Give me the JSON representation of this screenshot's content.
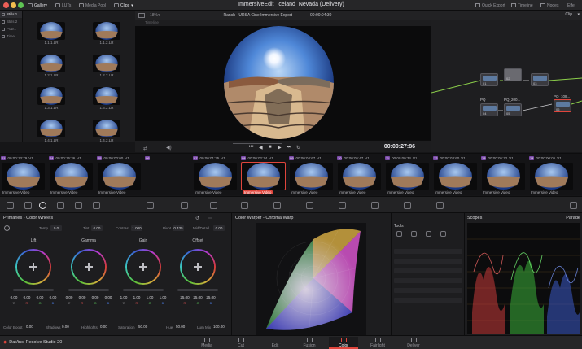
{
  "window": {
    "project_title": "ImmersiveEdit_Iceland_Nevada (Delivery)",
    "tabs": [
      {
        "label": "Gallery",
        "active": true
      },
      {
        "label": "LUTs",
        "active": false
      },
      {
        "label": "Media Pool",
        "active": false
      },
      {
        "label": "Clips",
        "active": true
      }
    ],
    "right_actions": [
      "Quick Export",
      "Timeline",
      "Nodes",
      "Effe"
    ]
  },
  "gallery": {
    "albums": [
      "Stills 1",
      "Stills 2",
      "Pow...",
      "Time..."
    ],
    "stills": [
      "1.1.1.LR",
      "1.1.2.LR",
      "1.2.1.LR",
      "1.2.2.LR",
      "1.3.1.LR",
      "1.3.2.LR",
      "1.4.1.LR",
      "1.4.2.LR"
    ]
  },
  "viewer": {
    "zoom": "18%",
    "clip_name": "Ranch - URSA Cine Immersive Export",
    "header_timecode": "00:00:04:30",
    "timeline_label": "Timeline",
    "timecode": "00:00:27:86"
  },
  "nodes": {
    "mode": "Clip",
    "node_labels": [
      "01",
      "02",
      "03",
      "04",
      "05",
      "06"
    ],
    "titles": [
      "PQ",
      "PQ_200...",
      "PQ_108..."
    ]
  },
  "clips": [
    {
      "num": "01",
      "tc": "00:00:13:79",
      "track": "V1",
      "name": "Immersive Video"
    },
    {
      "num": "04",
      "tc": "00:00:16:36",
      "track": "V1",
      "name": "Immersive Video"
    },
    {
      "num": "05",
      "tc": "00:00:00:00",
      "track": "V1",
      "name": "Immersive Video"
    },
    {
      "num": "06",
      "tc": "",
      "track": "",
      "name": ""
    },
    {
      "num": "07",
      "tc": "00:00:01:35",
      "track": "V1",
      "name": "Immersive Video"
    },
    {
      "num": "08",
      "tc": "00:00:02:74",
      "track": "V1",
      "name": "Immersive Video"
    },
    {
      "num": "09",
      "tc": "00:00:04:67",
      "track": "V1",
      "name": "Immersive Video"
    },
    {
      "num": "10",
      "tc": "00:00:05:47",
      "track": "V1",
      "name": "Immersive Video"
    },
    {
      "num": "11",
      "tc": "00:00:00:34",
      "track": "V1",
      "name": "Immersive Video"
    },
    {
      "num": "12",
      "tc": "00:00:03:60",
      "track": "V1",
      "name": "Immersive Video"
    },
    {
      "num": "13",
      "tc": "00:00:05:72",
      "track": "V1",
      "name": "Immersive Video"
    },
    {
      "num": "14",
      "tc": "00:00:00:05",
      "track": "V1",
      "name": "Immersive Video"
    }
  ],
  "primaries": {
    "title": "Primaries - Color Wheels",
    "params": [
      {
        "label": "Temp",
        "value": "0.0"
      },
      {
        "label": "Tint",
        "value": "0.00"
      },
      {
        "label": "Contrast",
        "value": "1.000"
      },
      {
        "label": "Pivot",
        "value": "0.435"
      },
      {
        "label": "Mid/Detail",
        "value": "0.00"
      }
    ],
    "wheels": [
      {
        "name": "Lift",
        "values": [
          "0.00",
          "0.00",
          "0.00",
          "0.00"
        ]
      },
      {
        "name": "Gamma",
        "values": [
          "0.00",
          "0.00",
          "0.00",
          "0.00"
        ]
      },
      {
        "name": "Gain",
        "values": [
          "1.00",
          "1.00",
          "1.00",
          "1.00"
        ]
      },
      {
        "name": "Offset",
        "values": [
          "25.00",
          "25.00",
          "25.00",
          ""
        ]
      }
    ],
    "channels": [
      "Y",
      "R",
      "G",
      "B"
    ],
    "bottom": [
      {
        "label": "Color Boost",
        "value": "0.00"
      },
      {
        "label": "Shadows",
        "value": "0.00"
      },
      {
        "label": "Highlights",
        "value": "0.00"
      },
      {
        "label": "Saturation",
        "value": "50.00"
      },
      {
        "label": "Hue",
        "value": "50.00"
      },
      {
        "label": "Lum Mix",
        "value": "100.00"
      }
    ]
  },
  "warper": {
    "title": "Color Warper - Chroma Warp"
  },
  "tools": {
    "title": "Tools"
  },
  "scopes": {
    "title": "Scopes",
    "mode": "Parade"
  },
  "pages": {
    "brand": "DaVinci Resolve Studio 20",
    "tabs": [
      {
        "label": "Media",
        "active": false
      },
      {
        "label": "Cut",
        "active": false
      },
      {
        "label": "Edit",
        "active": false
      },
      {
        "label": "Fusion",
        "active": false
      },
      {
        "label": "Color",
        "active": true
      },
      {
        "label": "Fairlight",
        "active": false
      },
      {
        "label": "Deliver",
        "active": false
      }
    ]
  },
  "colors": {
    "accent": "#e0453c",
    "clip_badge": "#7a4aa8"
  }
}
